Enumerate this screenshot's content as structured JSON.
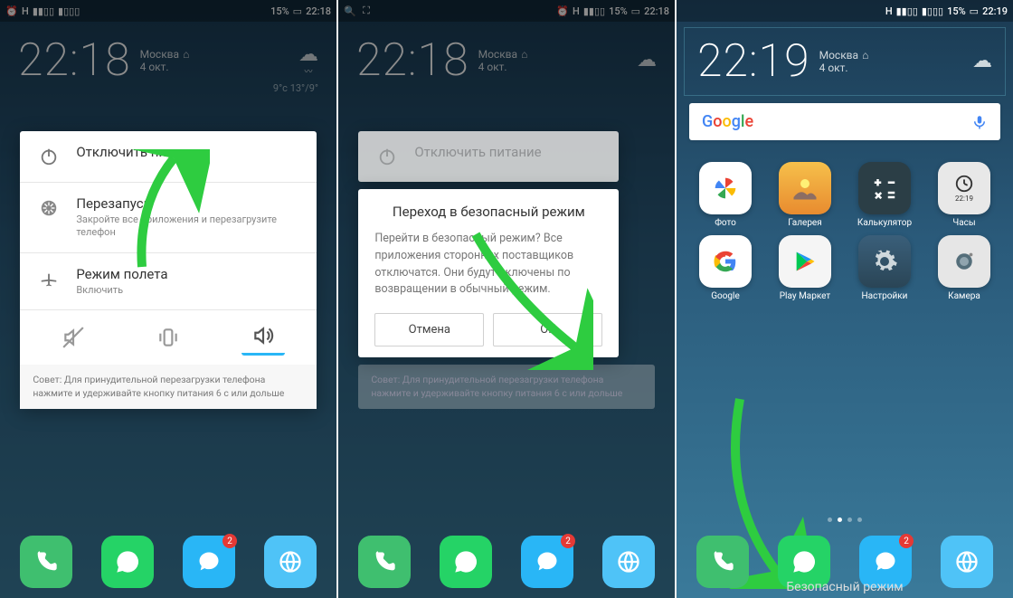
{
  "status": {
    "battery_pct": "15%",
    "time1": "22:18",
    "time3": "22:19",
    "network": "H"
  },
  "clock": {
    "time1": "22:18",
    "time3": "22:19",
    "city": "Москва",
    "date": "4 окт.",
    "temp": "9°c",
    "temp_range": "13°/9°"
  },
  "power_menu": {
    "power_off": "Отключить питание",
    "restart": "Перезапуск",
    "restart_sub": "Закройте все приложения и перезагрузите телефон",
    "airplane": "Режим полета",
    "airplane_sub": "Включить",
    "tip": "Совет: Для принудительной перезагрузки телефона нажмите и удерживайте кнопку питания 6 с или дольше"
  },
  "dialog": {
    "title": "Переход в безопасный режим",
    "body": "Перейти в безопасный режим? Все приложения сторонних поставщиков отключатся. Они будут включены по возвращении в обычный режим.",
    "cancel": "Отмена",
    "ok": "OK"
  },
  "search": {
    "label": "Google"
  },
  "apps": {
    "photos": "Фото",
    "gallery": "Галерея",
    "calculator": "Калькулятор",
    "clock": "Часы",
    "clock_time": "22:19",
    "google": "Google",
    "play": "Play Маркет",
    "settings": "Настройки",
    "camera": "Камера"
  },
  "dock": {
    "msg_badge": "2"
  },
  "safe_mode": "Безопасный режим"
}
